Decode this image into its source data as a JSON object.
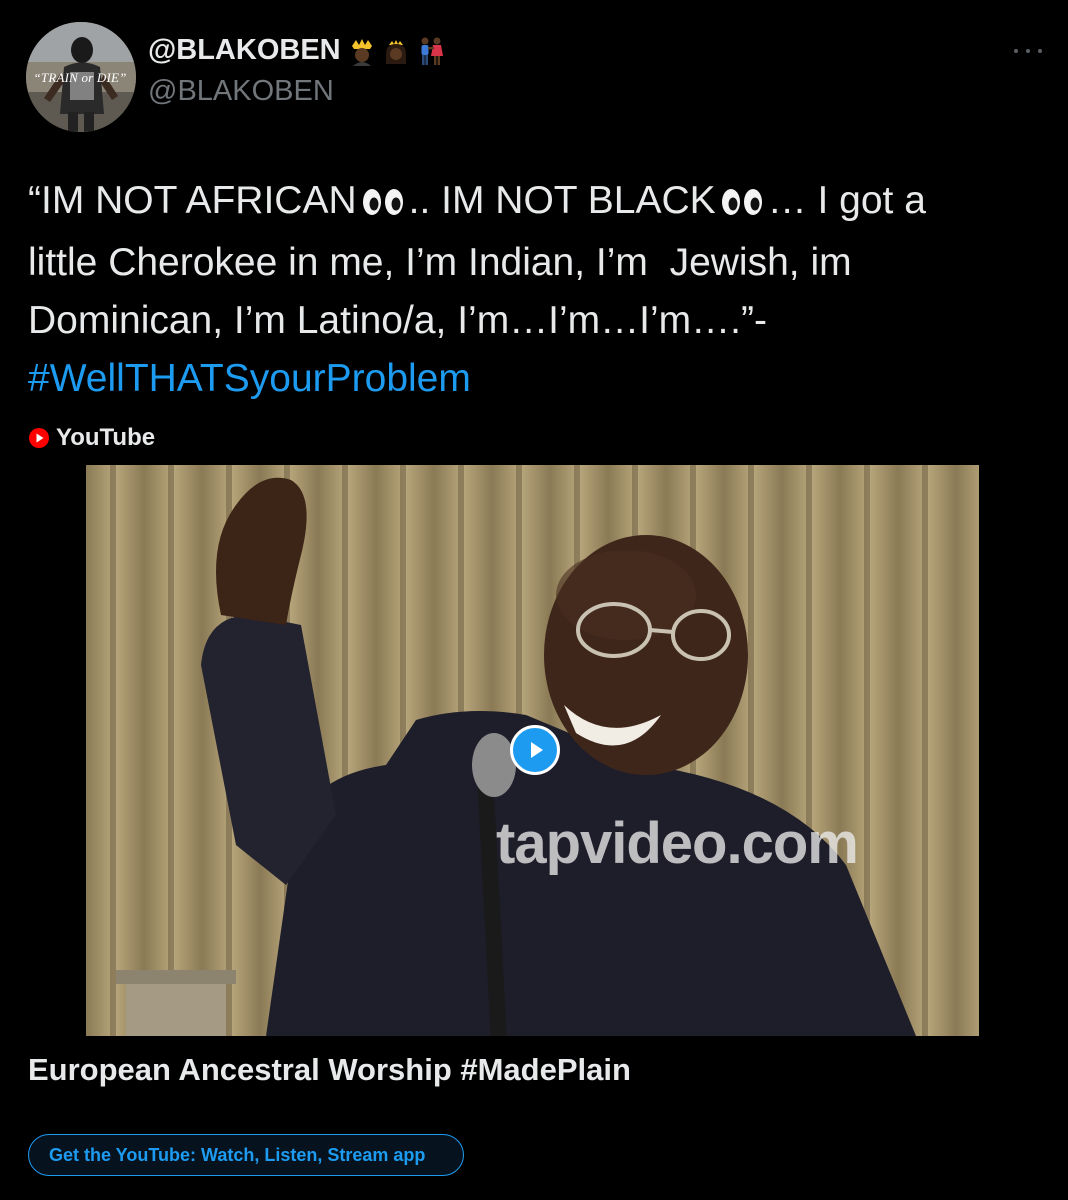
{
  "author": {
    "display_name": "@BLAKOBEN",
    "handle": "@BLAKOBEN",
    "avatar_caption": "“TRAIN or DIE”",
    "name_emojis": [
      "queen-emoji",
      "princess-emoji",
      "couple-emoji"
    ]
  },
  "tweet": {
    "line1_a": "“IM NOT AFRICAN",
    "line1_b": ".. IM NOT BLACK",
    "line1_c": "… I got a",
    "line2": "little Cherokee in me, I’m Indian, I’m  Jewish, im",
    "line3": "Dominican, I’m Latino/a, I’m…I’m…I’m….”-",
    "hashtag": "#WellTHATSyourProblem",
    "eyes_icon": "eyes-emoji"
  },
  "card": {
    "source_label": "YouTube",
    "watermark": "tapvideo.com",
    "video_title": "European Ancestral Worship #MadePlain",
    "cta_label": "Get the YouTube: Watch, Listen, Stream app"
  },
  "colors": {
    "background": "#000000",
    "text": "#e7e9ea",
    "muted": "#71767b",
    "accent": "#1d9bf0",
    "youtube_red": "#ff0000"
  }
}
